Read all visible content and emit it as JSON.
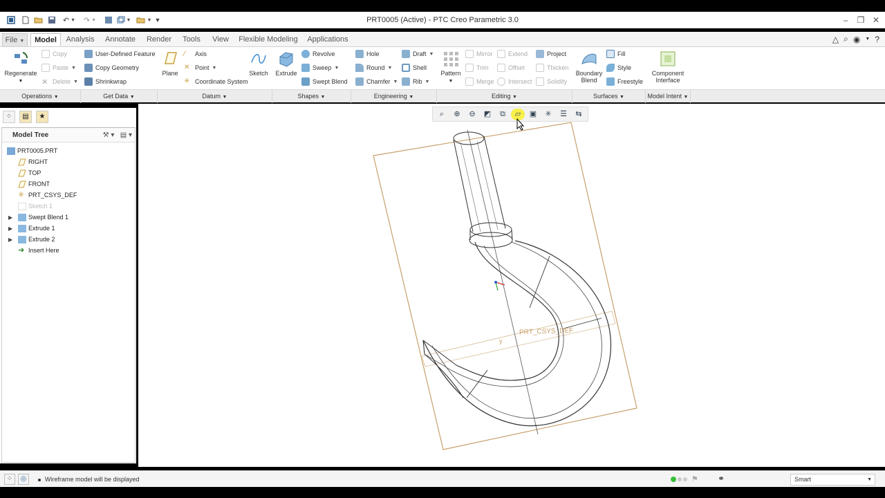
{
  "window": {
    "title": "PRT0005 (Active) - PTC Creo Parametric 3.0"
  },
  "tabs": [
    "File",
    "Model",
    "Analysis",
    "Annotate",
    "Render",
    "Tools",
    "View",
    "Flexible Modeling",
    "Applications"
  ],
  "ribbon": {
    "operations": {
      "regenerate": "Regenerate",
      "copy": "Copy",
      "paste": "Paste",
      "delete": "Delete",
      "group": "Operations"
    },
    "get_data": {
      "user_defined": "User-Defined Feature",
      "copy_geometry": "Copy Geometry",
      "shrinkwrap": "Shrinkwrap",
      "group": "Get Data"
    },
    "datum": {
      "plane": "Plane",
      "axis": "Axis",
      "point": "Point",
      "csys": "Coordinate System",
      "sketch": "Sketch",
      "group": "Datum"
    },
    "shapes": {
      "extrude": "Extrude",
      "revolve": "Revolve",
      "sweep": "Sweep",
      "swept_blend": "Swept Blend",
      "group": "Shapes"
    },
    "engineering": {
      "hole": "Hole",
      "round": "Round",
      "chamfer": "Chamfer",
      "draft": "Draft",
      "shell": "Shell",
      "rib": "Rib",
      "group": "Engineering"
    },
    "editing": {
      "pattern": "Pattern",
      "mirror": "Mirror",
      "trim": "Trim",
      "merge": "Merge",
      "extend": "Extend",
      "offset": "Offset",
      "intersect": "Intersect",
      "project": "Project",
      "thicken": "Thicken",
      "solidify": "Solidify",
      "group": "Editing"
    },
    "surfaces": {
      "boundary_blend_1": "Boundary",
      "boundary_blend_2": "Blend",
      "fill": "Fill",
      "style": "Style",
      "freestyle": "Freestyle",
      "group": "Surfaces"
    },
    "model_intent": {
      "component_1": "Component",
      "component_2": "Interface",
      "group": "Model Intent"
    }
  },
  "model_tree": {
    "header": "Model Tree",
    "items": [
      "PRT0005.PRT",
      "RIGHT",
      "TOP",
      "FRONT",
      "PRT_CSYS_DEF",
      "Sketch 1",
      "Swept Blend 1",
      "Extrude 1",
      "Extrude 2",
      "Insert Here"
    ]
  },
  "viewport": {
    "csys_label": "PRT_CSYS_DEF",
    "csys_axis": "y"
  },
  "status": {
    "message": "Wireframe model will be displayed",
    "filter": "Smart"
  },
  "colors": {
    "accent_orange": "#c8a06a",
    "tree_icon_blue": "#4a8fd0",
    "highlight_yellow": "#f7ef4a"
  }
}
